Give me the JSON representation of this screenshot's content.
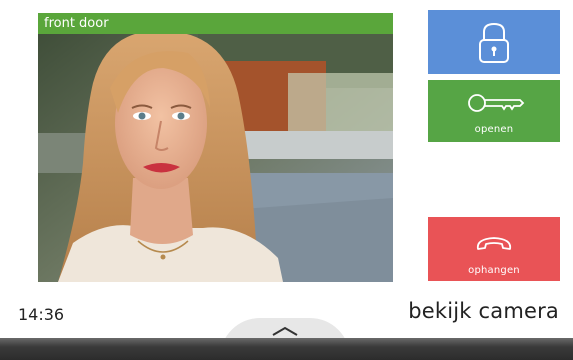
{
  "camera": {
    "name": "front door"
  },
  "buttons": {
    "unlock": {
      "icon": "padlock-icon"
    },
    "open": {
      "label": "openen",
      "icon": "key-icon"
    },
    "hangup": {
      "label": "ophangen",
      "icon": "phone-hangup-icon"
    }
  },
  "status": {
    "time": "14:36",
    "view_camera": "bekijk camera"
  },
  "pull_tab": {
    "icon": "chevron-up-icon"
  },
  "colors": {
    "unlock": "#5b8fd8",
    "open": "#56a545",
    "hangup": "#e95356",
    "label_bar": "#5aa63b"
  }
}
